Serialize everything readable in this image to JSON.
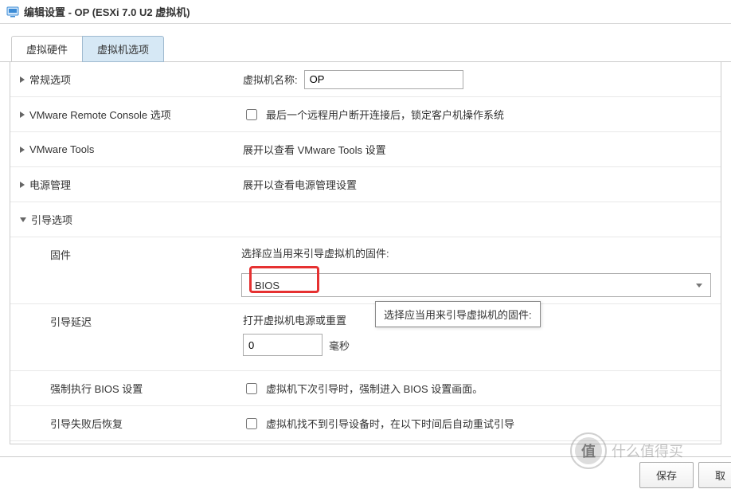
{
  "title": "编辑设置 - OP (ESXi 7.0 U2 虚拟机)",
  "tabs": {
    "hardware": "虚拟硬件",
    "options": "虚拟机选项"
  },
  "rows": {
    "general": {
      "label": "常规选项",
      "vmname_label": "虚拟机名称:",
      "vmname_value": "OP"
    },
    "vmrc": {
      "label": "VMware Remote Console 选项",
      "checkbox_label": "最后一个远程用户断开连接后，锁定客户机操作系统"
    },
    "vmtools": {
      "label": "VMware Tools",
      "hint": "展开以查看 VMware Tools 设置"
    },
    "power": {
      "label": "电源管理",
      "hint": "展开以查看电源管理设置"
    },
    "boot": {
      "label": "引导选项"
    },
    "firmware": {
      "label": "固件",
      "hint": "选择应当用来引导虚拟机的固件:",
      "value": "BIOS",
      "tooltip": "选择应当用来引导虚拟机的固件:"
    },
    "delay": {
      "label": "引导延迟",
      "hint": "打开虚拟机电源或重置后延迟引导顺序",
      "hint_short": "打开虚拟机电源或重置",
      "value": "0",
      "unit": "毫秒"
    },
    "forcebios": {
      "label": "强制执行 BIOS 设置",
      "checkbox_label": "虚拟机下次引导时，强制进入 BIOS 设置画面。"
    },
    "bootfail": {
      "label": "引导失败后恢复",
      "checkbox_label": "虚拟机找不到引导设备时，在以下时间后自动重试引导"
    }
  },
  "footer": {
    "save": "保存",
    "cancel": "取"
  },
  "watermark": {
    "char": "值",
    "text": "什么值得买"
  }
}
